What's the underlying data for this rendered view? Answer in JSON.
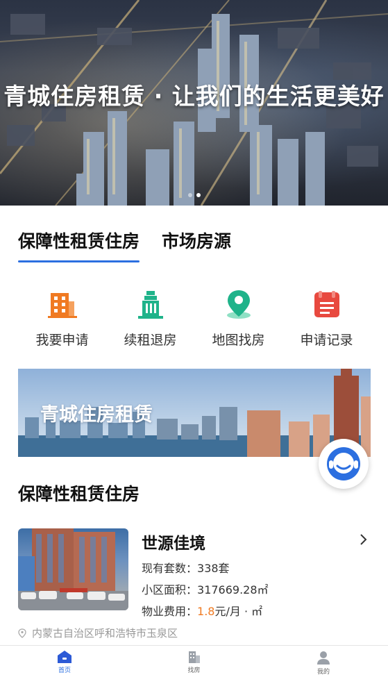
{
  "hero": {
    "title": "青城住房租赁 · 让我们的生活更美好",
    "dot_count": 2,
    "active_dot": 1
  },
  "tabs": [
    {
      "label": "保障性租赁住房",
      "active": true
    },
    {
      "label": "市场房源",
      "active": false
    }
  ],
  "actions": [
    {
      "label": "我要申请",
      "icon": "building-icon",
      "color": "#f07a22"
    },
    {
      "label": "续租退房",
      "icon": "skyscraper-icon",
      "color": "#1fb38a"
    },
    {
      "label": "地图找房",
      "icon": "map-pin-icon",
      "color": "#1fb38a"
    },
    {
      "label": "申请记录",
      "icon": "record-icon",
      "color": "#e8493f"
    }
  ],
  "banner2": {
    "title": "青城住房租赁"
  },
  "service": {
    "icon": "customer-service-icon",
    "color": "#2c6fe0"
  },
  "section": {
    "title": "保障性租赁住房"
  },
  "listing": {
    "name": "世源佳境",
    "units_label": "现有套数：",
    "units_value": "338套",
    "area_label": "小区面积：",
    "area_value": "317669.28㎡",
    "fee_label": "物业费用：",
    "fee_value": "1.8",
    "fee_unit": "元/月 · ㎡",
    "address": "内蒙古自治区呼和浩特市玉泉区"
  },
  "bottom_nav": [
    {
      "label": "首页",
      "icon": "home-icon",
      "active": true
    },
    {
      "label": "找房",
      "icon": "find-house-icon",
      "active": false
    },
    {
      "label": "我的",
      "icon": "user-icon",
      "active": false
    }
  ],
  "colors": {
    "accent": "#2c6fe0",
    "highlight": "#f07a22"
  }
}
